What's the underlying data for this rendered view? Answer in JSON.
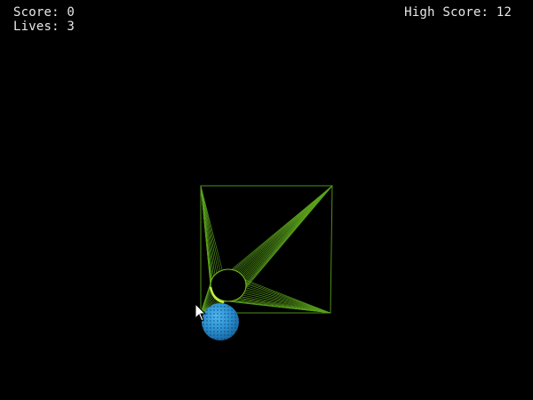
{
  "hud": {
    "score_label": "Score:",
    "score_value": "0",
    "lives_label": "Lives:",
    "lives_value": "3",
    "highscore_label": "High Score:",
    "highscore_value": "12"
  },
  "colors": {
    "background": "#000000",
    "hud_text": "#e8e8e8",
    "wireframe_green": "#5aa21c",
    "wireframe_bright": "#b8e830",
    "ball_blue": "#2a8fd0"
  },
  "icons": {
    "cursor": "arrow-pointer-icon"
  }
}
